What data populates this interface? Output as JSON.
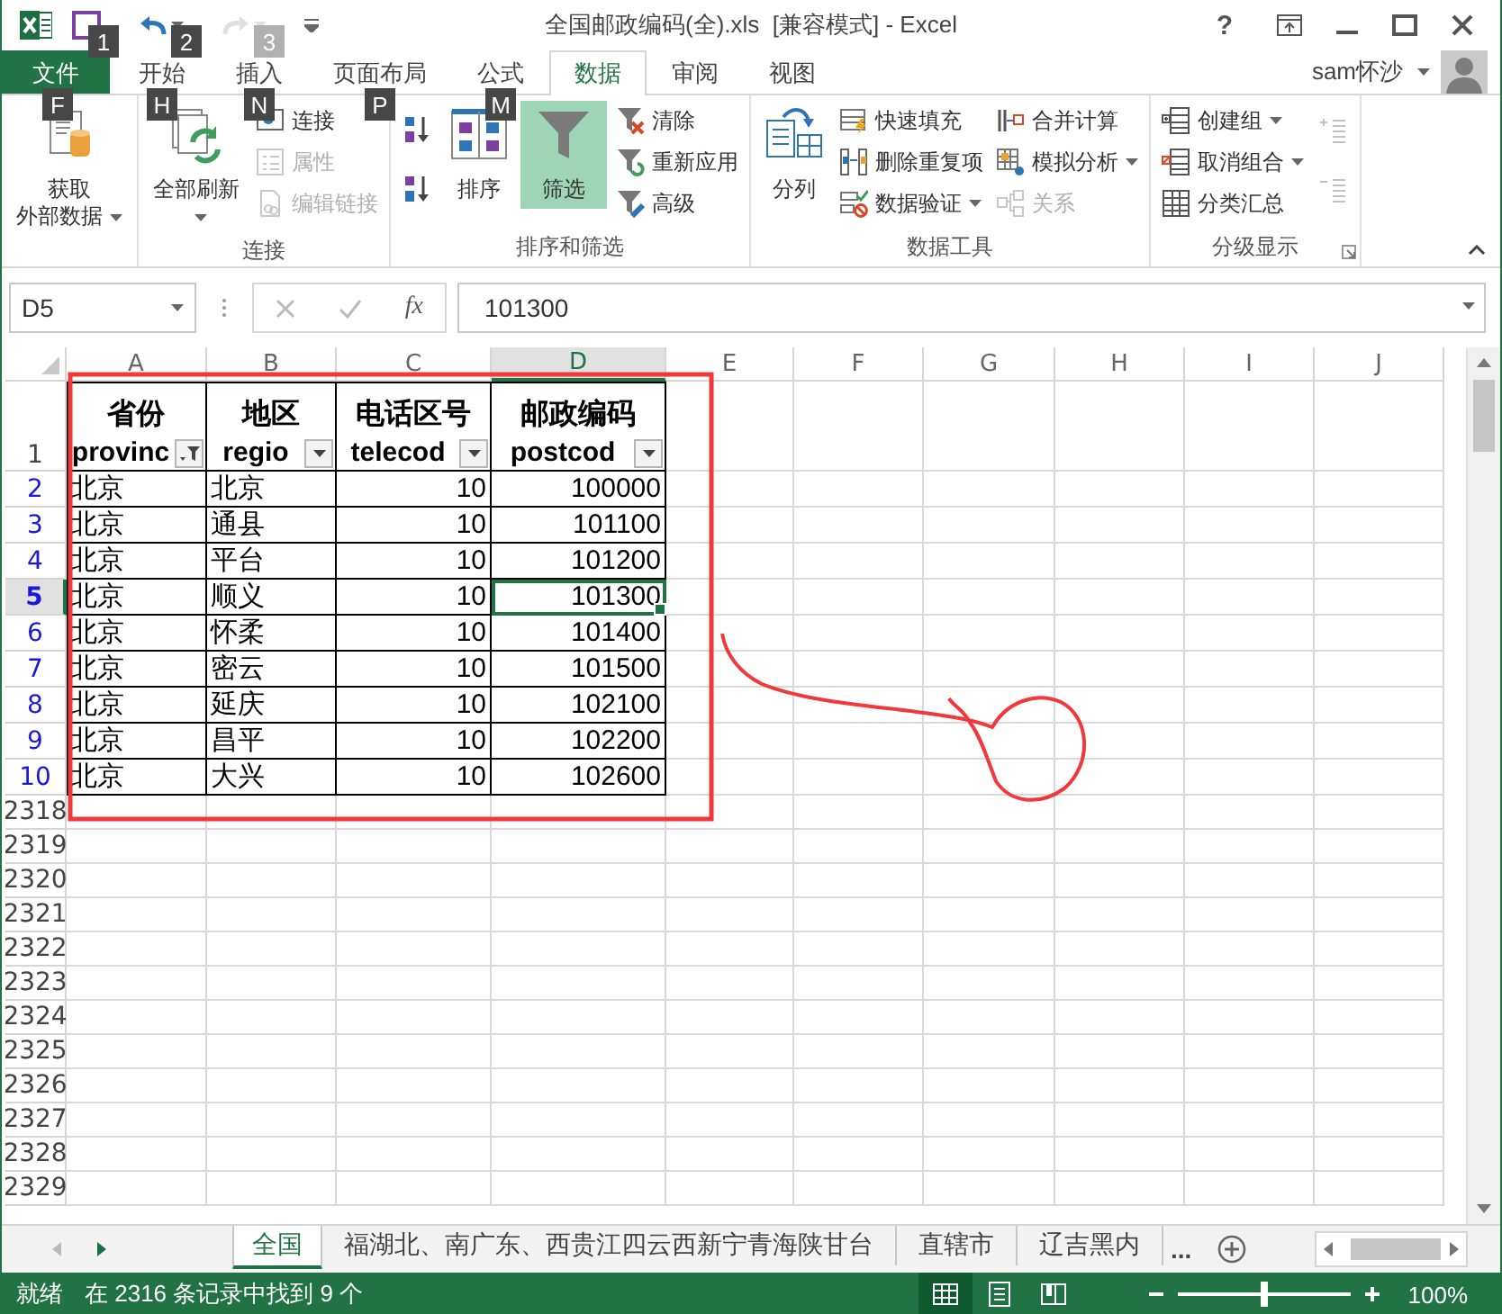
{
  "window": {
    "title": "全国邮政编码(全).xls  [兼容模式] - Excel",
    "help": "?",
    "user": "sam怀沙"
  },
  "quick_access": [
    {
      "kind": "save",
      "key_tip": "1",
      "disabled": false
    },
    {
      "kind": "undo",
      "key_tip": "2",
      "disabled": false
    },
    {
      "kind": "redo",
      "key_tip": "3",
      "disabled": true
    },
    {
      "kind": "customize",
      "disabled": false
    }
  ],
  "tabs": [
    {
      "label": "文件",
      "kind": "file",
      "key_tip": "F",
      "selected": false
    },
    {
      "label": "开始",
      "kind": "tab",
      "key_tip": "H",
      "selected": false
    },
    {
      "label": "插入",
      "kind": "tab",
      "key_tip": "N",
      "selected": false
    },
    {
      "label": "页面布局",
      "kind": "tab",
      "key_tip": "P",
      "selected": false
    },
    {
      "label": "公式",
      "kind": "tab",
      "key_tip": "M",
      "selected": false
    },
    {
      "label": "数据",
      "kind": "tab",
      "selected": true
    },
    {
      "label": "审阅",
      "kind": "tab",
      "selected": false
    },
    {
      "label": "视图",
      "kind": "tab",
      "selected": false
    }
  ],
  "ribbon_groups": [
    {
      "dialog_launcher": false,
      "columns": [
        [
          {
            "label": "获取",
            "label_2": "外部数据",
            "kind": "large",
            "dropdown": true,
            "disabled": false,
            "on": false
          }
        ]
      ]
    },
    {
      "label": "连接",
      "dialog_launcher": false,
      "columns": [
        [
          {
            "label": "全部刷新",
            "kind": "large",
            "dropdown": true,
            "disabled": false,
            "on": false
          }
        ],
        [
          {
            "label": "连接",
            "kind": "small",
            "dropdown": false,
            "disabled": false,
            "on": false
          },
          {
            "label": "属性",
            "kind": "small",
            "dropdown": false,
            "disabled": true,
            "on": false
          },
          {
            "label": "编辑链接",
            "kind": "small",
            "dropdown": false,
            "disabled": true,
            "on": false
          }
        ]
      ]
    },
    {
      "label": "排序和筛选",
      "dialog_launcher": false,
      "columns": [
        [
          {
            "kind": "icon",
            "dropdown": false,
            "disabled": false,
            "on": false
          },
          {
            "kind": "icon",
            "dropdown": false,
            "disabled": false,
            "on": false
          }
        ],
        [
          {
            "label": "排序",
            "kind": "large",
            "dropdown": false,
            "disabled": false,
            "on": false
          }
        ],
        [
          {
            "label": "筛选",
            "kind": "large",
            "dropdown": false,
            "disabled": false,
            "on": true
          }
        ],
        [
          {
            "label": "清除",
            "kind": "small",
            "dropdown": false,
            "disabled": false,
            "on": false
          },
          {
            "label": "重新应用",
            "kind": "small",
            "dropdown": false,
            "disabled": false,
            "on": false
          },
          {
            "label": "高级",
            "kind": "small",
            "dropdown": false,
            "disabled": false,
            "on": false
          }
        ]
      ]
    },
    {
      "label": "数据工具",
      "dialog_launcher": false,
      "columns": [
        [
          {
            "label": "分列",
            "kind": "large",
            "dropdown": false,
            "disabled": false,
            "on": false
          }
        ],
        [
          {
            "label": "快速填充",
            "kind": "small",
            "dropdown": false,
            "disabled": false,
            "on": false
          },
          {
            "label": "删除重复项",
            "kind": "small",
            "dropdown": false,
            "disabled": false,
            "on": false
          },
          {
            "label": "数据验证",
            "kind": "small",
            "dropdown": true,
            "disabled": false,
            "on": false
          }
        ],
        [
          {
            "label": "合并计算",
            "kind": "small",
            "dropdown": false,
            "disabled": false,
            "on": false
          },
          {
            "label": "模拟分析",
            "kind": "small",
            "dropdown": true,
            "disabled": false,
            "on": false
          },
          {
            "label": "关系",
            "kind": "small",
            "dropdown": false,
            "disabled": true,
            "on": false
          }
        ]
      ]
    },
    {
      "label": "分级显示",
      "dialog_launcher": true,
      "columns": [
        [
          {
            "label": "创建组",
            "kind": "small",
            "dropdown": true,
            "disabled": false,
            "on": false
          },
          {
            "label": "取消组合",
            "kind": "small",
            "dropdown": true,
            "disabled": false,
            "on": false
          },
          {
            "label": "分类汇总",
            "kind": "small",
            "dropdown": false,
            "disabled": false,
            "on": false
          }
        ],
        [
          {
            "kind": "icon",
            "dropdown": false,
            "disabled": true,
            "on": false
          },
          {
            "kind": "icon",
            "dropdown": false,
            "disabled": true,
            "on": false
          }
        ]
      ]
    }
  ],
  "formula_bar": {
    "name_box": "D5",
    "function_label": "fx",
    "value": "101300"
  },
  "sheet": {
    "columns": [
      {
        "letter": "A",
        "kind": "text",
        "selected": false
      },
      {
        "letter": "B",
        "kind": "text",
        "selected": false
      },
      {
        "letter": "C",
        "kind": "number",
        "selected": false
      },
      {
        "letter": "D",
        "kind": "number",
        "selected": true
      },
      {
        "letter": "E",
        "selected": false
      },
      {
        "letter": "F",
        "selected": false
      },
      {
        "letter": "G",
        "selected": false
      },
      {
        "letter": "H",
        "selected": false
      },
      {
        "letter": "I",
        "selected": false
      },
      {
        "letter": "J",
        "selected": false
      }
    ],
    "header": {
      "number": "1",
      "cells": [
        {
          "title": "省份",
          "subtitle": "provinc",
          "filtered": true
        },
        {
          "title": "地区",
          "subtitle": "regio",
          "filtered": false
        },
        {
          "title": "电话区号",
          "subtitle": "telecod",
          "filtered": false
        },
        {
          "title": "邮政编码",
          "subtitle": "postcod",
          "filtered": false
        }
      ]
    },
    "rows": [
      {
        "number": "2",
        "filtered": true,
        "selected": false,
        "cells": [
          "北京",
          "北京",
          "10",
          "100000"
        ]
      },
      {
        "number": "3",
        "filtered": true,
        "selected": false,
        "cells": [
          "北京",
          "通县",
          "10",
          "101100"
        ]
      },
      {
        "number": "4",
        "filtered": true,
        "selected": false,
        "cells": [
          "北京",
          "平台",
          "10",
          "101200"
        ]
      },
      {
        "number": "5",
        "filtered": true,
        "selected": true,
        "cells": [
          "北京",
          "顺义",
          "10",
          "101300"
        ]
      },
      {
        "number": "6",
        "filtered": true,
        "selected": false,
        "cells": [
          "北京",
          "怀柔",
          "10",
          "101400"
        ]
      },
      {
        "number": "7",
        "filtered": true,
        "selected": false,
        "cells": [
          "北京",
          "密云",
          "10",
          "101500"
        ]
      },
      {
        "number": "8",
        "filtered": true,
        "selected": false,
        "cells": [
          "北京",
          "延庆",
          "10",
          "102100"
        ]
      },
      {
        "number": "9",
        "filtered": true,
        "selected": false,
        "cells": [
          "北京",
          "昌平",
          "10",
          "102200"
        ]
      },
      {
        "number": "10",
        "filtered": true,
        "selected": false,
        "cells": [
          "北京",
          "大兴",
          "10",
          "102600"
        ]
      }
    ],
    "empty_rows": [
      "2318",
      "2319",
      "2320",
      "2321",
      "2322",
      "2323",
      "2324",
      "2325",
      "2326",
      "2327",
      "2328",
      "2329"
    ]
  },
  "sheet_tabs": {
    "tabs": [
      {
        "label": "全国",
        "selected": true
      },
      {
        "label": "福湖北、南广东、西贵江四云西新宁青海陕甘台",
        "selected": false
      },
      {
        "label": "直辖市",
        "selected": false
      },
      {
        "label": "辽吉黑内",
        "selected": false
      }
    ],
    "more": "..."
  },
  "annotations": {
    "rectangle": true,
    "curve": true
  },
  "status_bar": {
    "ready": "就绪",
    "message": "在 2316 条记录中找到 9 个",
    "views": [
      {
        "kind": "normal",
        "selected": true
      },
      {
        "kind": "page_layout",
        "selected": false
      },
      {
        "kind": "page_break",
        "selected": false
      }
    ],
    "zoom": {
      "level": 0.5,
      "reading": "100%"
    }
  }
}
